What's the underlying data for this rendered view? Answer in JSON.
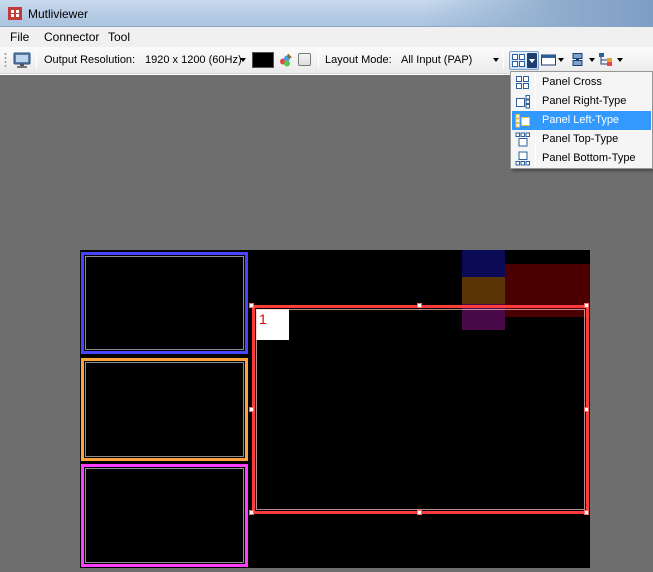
{
  "window": {
    "title": "Mutliviewer"
  },
  "menu": {
    "items": [
      "File",
      "Connector",
      "Tool"
    ]
  },
  "toolbar": {
    "output_resolution_label": "Output Resolution:",
    "output_resolution_value": "1920 x 1200 (60Hz)",
    "background_color": "#000000",
    "layout_mode_label": "Layout Mode:",
    "layout_mode_value": "All Input (PAP)"
  },
  "layout_menu": {
    "items": [
      {
        "label": "Panel Cross",
        "icon": "panel-cross-icon",
        "selected": false
      },
      {
        "label": "Panel Right-Type",
        "icon": "panel-right-type-icon",
        "selected": false
      },
      {
        "label": "Panel Left-Type",
        "icon": "panel-left-type-icon",
        "selected": true
      },
      {
        "label": "Panel Top-Type",
        "icon": "panel-top-type-icon",
        "selected": false
      },
      {
        "label": "Panel Bottom-Type",
        "icon": "panel-bottom-type-icon",
        "selected": false
      }
    ]
  },
  "canvas": {
    "main_window_label": "1",
    "colors": {
      "window_1": "#ff3c3c",
      "window_2": "#4646ff",
      "window_3": "#ffa23c",
      "window_4": "#ff3cff",
      "workspace": "#6e6e6e"
    }
  }
}
